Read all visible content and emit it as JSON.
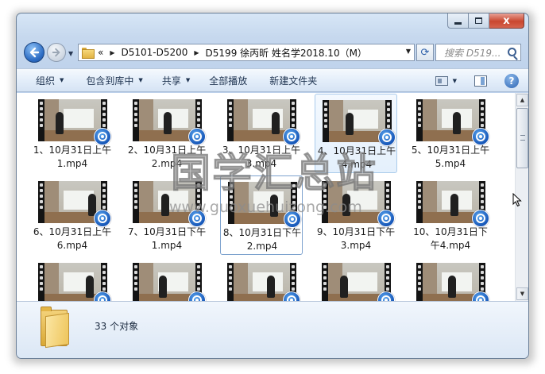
{
  "window": {
    "minimize_glyph": "",
    "close_glyph": "x"
  },
  "address": {
    "overflow": "«",
    "crumbs": [
      "D5101-D5200",
      "D5199 徐丙昕  姓名学2018.10（M）"
    ],
    "separator": "▶"
  },
  "search": {
    "placeholder": "搜索 D519..."
  },
  "toolbar": {
    "organize": "组织",
    "include_library": "包含到库中",
    "share": "共享",
    "play_all": "全部播放",
    "new_folder": "新建文件夹"
  },
  "files": [
    {
      "label": "1、10月31日上午1.mp4"
    },
    {
      "label": "2、10月31日上午2.mp4"
    },
    {
      "label": "3、10月31日上午3.mp4"
    },
    {
      "label": "4、10月31日上午4.mp4",
      "state": "selected"
    },
    {
      "label": "5、10月31日上午5.mp4"
    },
    {
      "label": "6、10月31日上午6.mp4"
    },
    {
      "label": "7、10月31日下午1.mp4"
    },
    {
      "label": "8、10月31日下午2.mp4",
      "state": "focused"
    },
    {
      "label": "9、10月31日下午3.mp4"
    },
    {
      "label": "10、10月31日下午4.mp4"
    },
    {
      "label": ""
    },
    {
      "label": ""
    },
    {
      "label": ""
    },
    {
      "label": ""
    },
    {
      "label": ""
    }
  ],
  "details": {
    "count": "33 个对象"
  },
  "watermark": {
    "chinese": "国学汇总站",
    "url": "www.guoxuehuizong.com"
  },
  "colors": {
    "accent": "#2c6cc4",
    "window_frame": "#bcd0ea",
    "close_button": "#c9472f",
    "selection": "#e4f0fc"
  }
}
